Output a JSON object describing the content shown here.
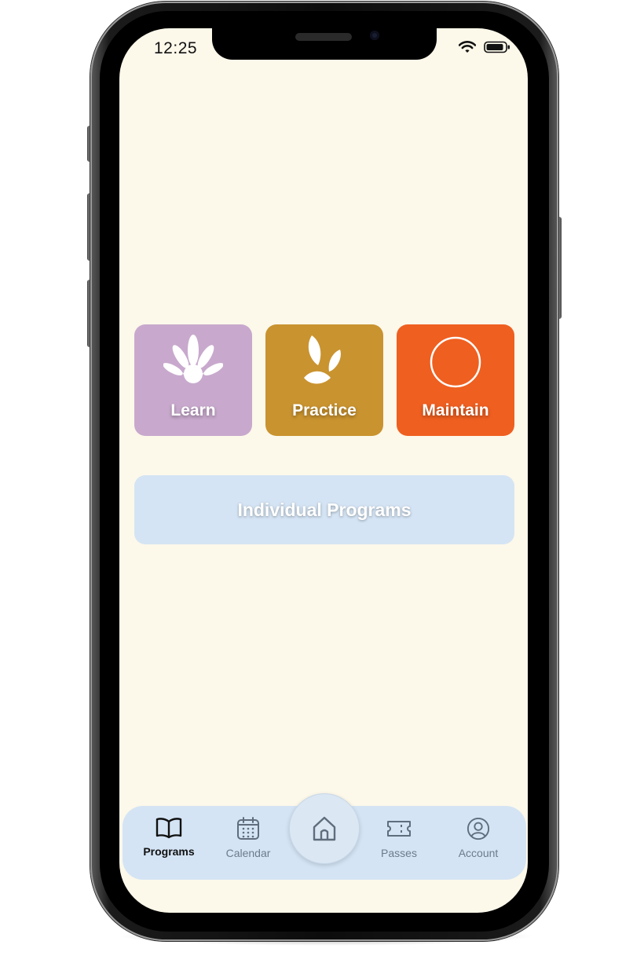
{
  "status_bar": {
    "time": "12:25"
  },
  "categories": [
    {
      "label": "Learn",
      "icon": "leaf-burst-icon",
      "color": "#c8a9cd"
    },
    {
      "label": "Practice",
      "icon": "sprout-icon",
      "color": "#c9932f"
    },
    {
      "label": "Maintain",
      "icon": "circle-icon",
      "color": "#ef5f20"
    }
  ],
  "individual_programs": {
    "label": "Individual Programs",
    "color": "#d4e4f4"
  },
  "bottom_nav": {
    "items": [
      {
        "label": "Programs",
        "icon": "book-icon",
        "active": true
      },
      {
        "label": "Calendar",
        "icon": "calendar-icon",
        "active": false
      },
      {
        "label": "Passes",
        "icon": "ticket-icon",
        "active": false
      },
      {
        "label": "Account",
        "icon": "account-icon",
        "active": false
      }
    ],
    "home_icon": "home-icon"
  },
  "colors": {
    "background": "#fcf8ea",
    "nav_background": "#d4e4f4",
    "active_text": "#111111",
    "inactive_text": "#6d7b8b"
  }
}
